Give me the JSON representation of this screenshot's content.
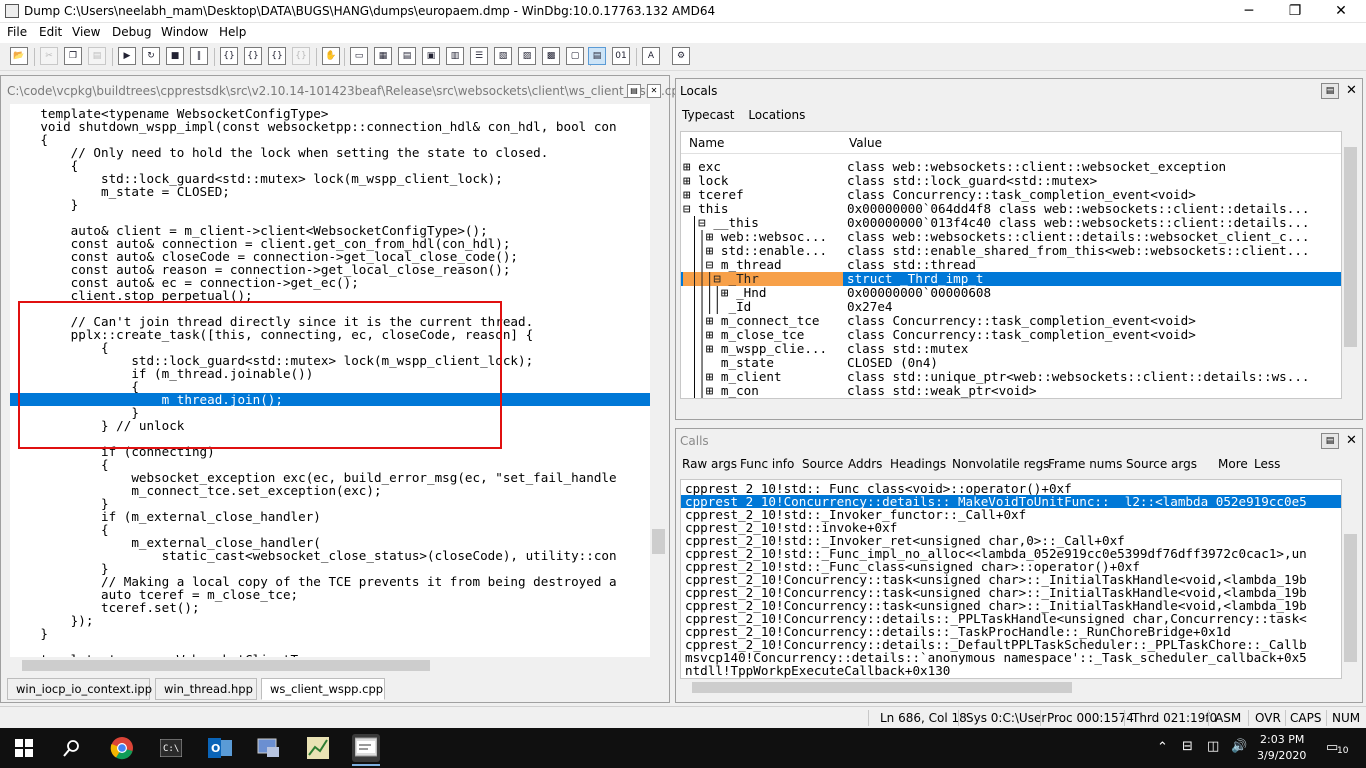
{
  "window": {
    "title": "Dump C:\\Users\\neelabh_mam\\Desktop\\DATA\\BUGS\\HANG\\dumps\\europaem.dmp - WinDbg:10.0.17763.132 AMD64",
    "minimize": "─",
    "restore": "❐",
    "close": "✕"
  },
  "menu": [
    "File",
    "Edit",
    "View",
    "Debug",
    "Window",
    "Help"
  ],
  "toolbar": [
    "open-icon",
    "cut-icon",
    "copy-icon",
    "paste-icon",
    "go-icon",
    "restart-icon",
    "stop-icon",
    "break-icon",
    "step-into-icon",
    "step-over-icon",
    "step-out-icon",
    "run-to-cursor-icon",
    "hand-icon",
    "command-icon",
    "watch-icon",
    "locals-icon",
    "registers-icon",
    "memory-icon",
    "calls-icon",
    "disassembly-icon",
    "scratch-icon",
    "source-mode-icon",
    "hex-icon",
    "font-icon",
    "options-icon"
  ],
  "source": {
    "path": "C:\\code\\vcpkg\\buildtrees\\cpprestsdk\\src\\v2.10.14-101423beaf\\Release\\src\\websockets\\client\\ws_client_wspp.cpp",
    "lines": [
      "    template<typename WebsocketConfigType>",
      "    void shutdown_wspp_impl(const websocketpp::connection_hdl& con_hdl, bool con",
      "    {",
      "        // Only need to hold the lock when setting the state to closed.",
      "        {",
      "            std::lock_guard<std::mutex> lock(m_wspp_client_lock);",
      "            m_state = CLOSED;",
      "        }",
      "",
      "        auto& client = m_client->client<WebsocketConfigType>();",
      "        const auto& connection = client.get_con_from_hdl(con_hdl);",
      "        const auto& closeCode = connection->get_local_close_code();",
      "        const auto& reason = connection->get_local_close_reason();",
      "        const auto& ec = connection->get_ec();",
      "        client.stop_perpetual();",
      "",
      "        // Can't join thread directly since it is the current thread.",
      "        pplx::create_task([this, connecting, ec, closeCode, reason] {",
      "            {",
      "                std::lock_guard<std::mutex> lock(m_wspp_client_lock);",
      "                if (m_thread.joinable())",
      "                {",
      "                    m_thread.join();",
      "                }",
      "            } // unlock",
      "",
      "            if (connecting)",
      "            {",
      "                websocket_exception exc(ec, build_error_msg(ec, \"set_fail_handle",
      "                m_connect_tce.set_exception(exc);",
      "            }",
      "            if (m_external_close_handler)",
      "            {",
      "                m_external_close_handler(",
      "                    static_cast<websocket_close_status>(closeCode), utility::con",
      "            }",
      "            // Making a local copy of the TCE prevents it from being destroyed a",
      "            auto tceref = m_close_tce;",
      "            tceref.set();",
      "        });",
      "    }",
      "",
      "    template<typename WebsocketClientType>"
    ],
    "highlighted_line": 22,
    "tabs": [
      "win_iocp_io_context.ipp",
      "win_thread.hpp",
      "ws_client_wspp.cpp"
    ],
    "active_tab": 2
  },
  "locals": {
    "title": "Locals",
    "links": [
      "Typecast",
      "Locations"
    ],
    "col_name": "Name",
    "col_value": "Value",
    "rows": [
      {
        "name": "⊞ exc",
        "value": "class web::websockets::client::websocket_exception"
      },
      {
        "name": "⊞ lock",
        "value": "class std::lock_guard<std::mutex>"
      },
      {
        "name": "⊞ tceref",
        "value": "class Concurrency::task_completion_event<void>"
      },
      {
        "name": "⊟ this",
        "value": "0x00000000`064dd4f8 class web::websockets::client::details..."
      },
      {
        "name": " │⊟ __this",
        "value": "0x00000000`013f4c40 class web::websockets::client::details..."
      },
      {
        "name": " ││⊞ web::websoc...",
        "value": "class web::websockets::client::details::websocket_client_c..."
      },
      {
        "name": " ││⊞ std::enable...",
        "value": "class std::enable_shared_from_this<web::websockets::client..."
      },
      {
        "name": " ││⊟ m_thread",
        "value": "class std::thread"
      },
      {
        "name": " │││⊟ _Thr",
        "value": "struct _Thrd_imp_t"
      },
      {
        "name": " ││││⊞ _Hnd",
        "value": "0x00000000`00000608"
      },
      {
        "name": " ││││ _Id",
        "value": "0x27e4"
      },
      {
        "name": " ││⊞ m_connect_tce",
        "value": "class Concurrency::task_completion_event<void>"
      },
      {
        "name": " ││⊞ m_close_tce",
        "value": "class Concurrency::task_completion_event<void>"
      },
      {
        "name": " ││⊞ m_wspp_clie...",
        "value": "class std::mutex"
      },
      {
        "name": " ││  m_state",
        "value": "CLOSED (0n4)"
      },
      {
        "name": " ││⊞ m_client",
        "value": "class std::unique_ptr<web::websockets::client::details::ws..."
      },
      {
        "name": " ││⊞ m_con",
        "value": "class std::weak_ptr<void>"
      }
    ],
    "selected_row": 8
  },
  "calls": {
    "title": "Calls",
    "links": [
      "Raw args",
      "Func info",
      "Source",
      "Addrs",
      "Headings",
      "Nonvolatile regs",
      "Frame nums",
      "Source args",
      "More",
      "Less"
    ],
    "rows": [
      "cpprest_2_10!std::_Func_class<void>::operator()+0xf",
      "cpprest_2_10!Concurrency::details::_MakeVoidToUnitFunc::__l2::<lambda_052e919cc0e5",
      "cpprest_2_10!std::_Invoker_functor::_Call+0xf",
      "cpprest_2_10!std::invoke+0xf",
      "cpprest_2_10!std::_Invoker_ret<unsigned char,0>::_Call+0xf",
      "cpprest_2_10!std::_Func_impl_no_alloc<<lambda_052e919cc0e5399df76dff3972c0cac1>,un",
      "cpprest_2_10!std::_Func_class<unsigned char>::operator()+0xf",
      "cpprest_2_10!Concurrency::task<unsigned char>::_InitialTaskHandle<void,<lambda_19b",
      "cpprest_2_10!Concurrency::task<unsigned char>::_InitialTaskHandle<void,<lambda_19b",
      "cpprest_2_10!Concurrency::task<unsigned char>::_InitialTaskHandle<void,<lambda_19b",
      "cpprest_2_10!Concurrency::details::_PPLTaskHandle<unsigned char,Concurrency::task<",
      "cpprest_2_10!Concurrency::details::_TaskProcHandle::_RunChoreBridge+0x1d",
      "cpprest_2_10!Concurrency::details::_DefaultPPLTaskScheduler::_PPLTaskChore::_Callb",
      "msvcp140!Concurrency::details::`anonymous namespace'::_Task_scheduler_callback+0x5",
      "ntdll!TppWorkpExecuteCallback+0x130"
    ],
    "selected_row": 1
  },
  "status": {
    "position": "Ln 686, Col 18",
    "sys": "Sys 0:C:\\User",
    "proc": "Proc 000:1574",
    "thrd": "Thrd 021:19f0",
    "asm": "ASM",
    "ovr": "OVR",
    "caps": "CAPS",
    "num": "NUM"
  },
  "taskbar": {
    "time": "2:03 PM",
    "date": "3/9/2020",
    "notifications": "10"
  }
}
